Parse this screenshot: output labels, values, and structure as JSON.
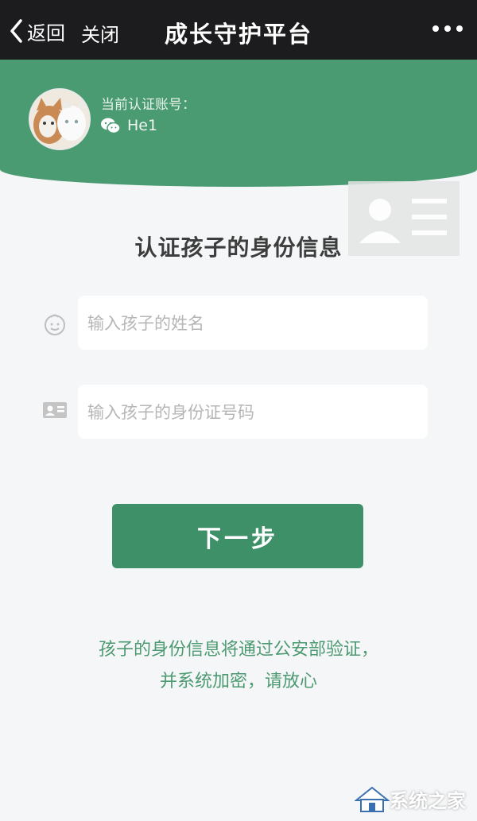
{
  "nav": {
    "back_label": "返回",
    "close_label": "关闭",
    "title": "成长守护平台"
  },
  "account": {
    "label": "当前认证账号：",
    "name": "He1"
  },
  "form": {
    "title": "认证孩子的身份信息",
    "name_placeholder": "输入孩子的姓名",
    "id_placeholder": "输入孩子的身份证号码",
    "next_label": "下一步"
  },
  "notice": {
    "line1": "孩子的身份信息将通过公安部验证，",
    "line2": "并系统加密，请放心"
  },
  "watermark": {
    "text": "系统之家"
  },
  "colors": {
    "header_green": "#4a9a72",
    "button_green": "#3e9068",
    "notice_green": "#4d9a72",
    "nav_dark": "#1c1c1e"
  }
}
